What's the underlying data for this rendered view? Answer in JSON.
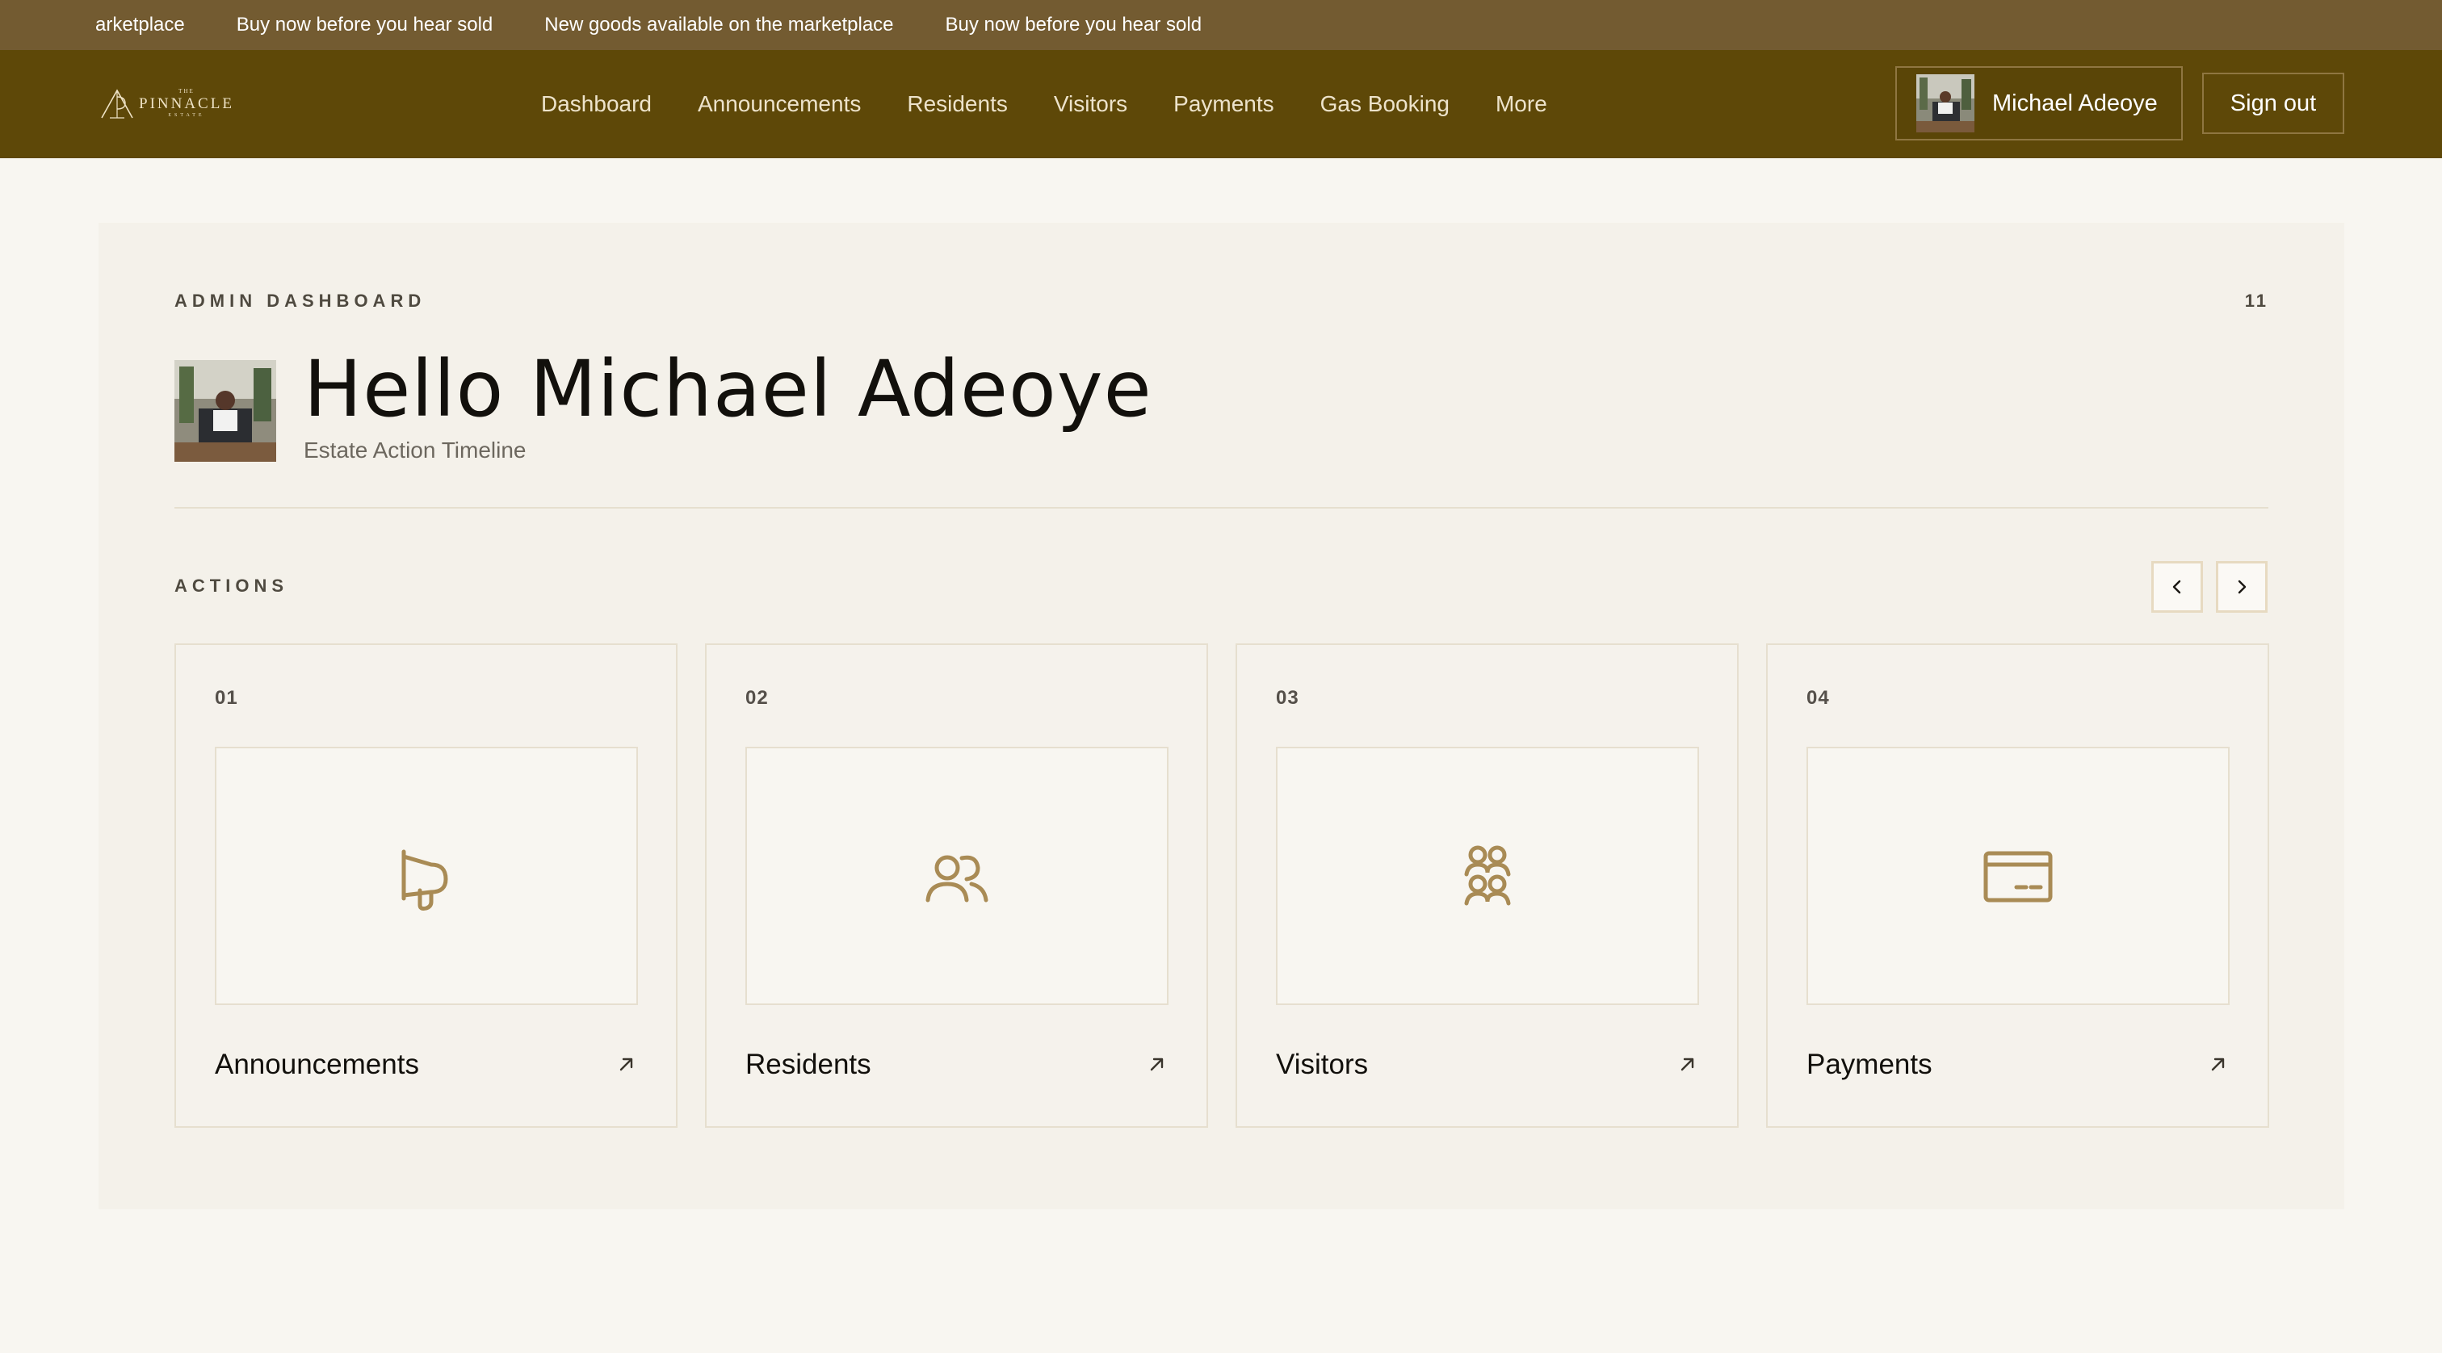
{
  "ticker": {
    "items": [
      "arketplace",
      "Buy now before you hear sold",
      "New goods available on the marketplace",
      "Buy now before you hear sold"
    ]
  },
  "header": {
    "logo": {
      "top": "THE",
      "name": "PINNACLE",
      "bottom": "ESTATE"
    },
    "nav": [
      "Dashboard",
      "Announcements",
      "Residents",
      "Visitors",
      "Payments",
      "Gas Booking",
      "More"
    ],
    "user_name": "Michael Adeoye",
    "signout_label": "Sign out"
  },
  "dashboard": {
    "kicker": "ADMIN DASHBOARD",
    "counter": "11",
    "greeting": "Hello Michael Adeoye",
    "subtitle": "Estate Action Timeline",
    "actions_label": "ACTIONS",
    "cards": [
      {
        "num": "01",
        "title": "Announcements",
        "icon": "megaphone-icon"
      },
      {
        "num": "02",
        "title": "Residents",
        "icon": "users-icon"
      },
      {
        "num": "03",
        "title": "Visitors",
        "icon": "group-icon"
      },
      {
        "num": "04",
        "title": "Payments",
        "icon": "credit-card-icon"
      }
    ]
  },
  "colors": {
    "ticker_bg": "#735b31",
    "header_bg": "#5e4808",
    "accent_gold": "#a98b55",
    "page_bg": "#f8f6f1",
    "panel_bg": "#f4f1ea"
  }
}
